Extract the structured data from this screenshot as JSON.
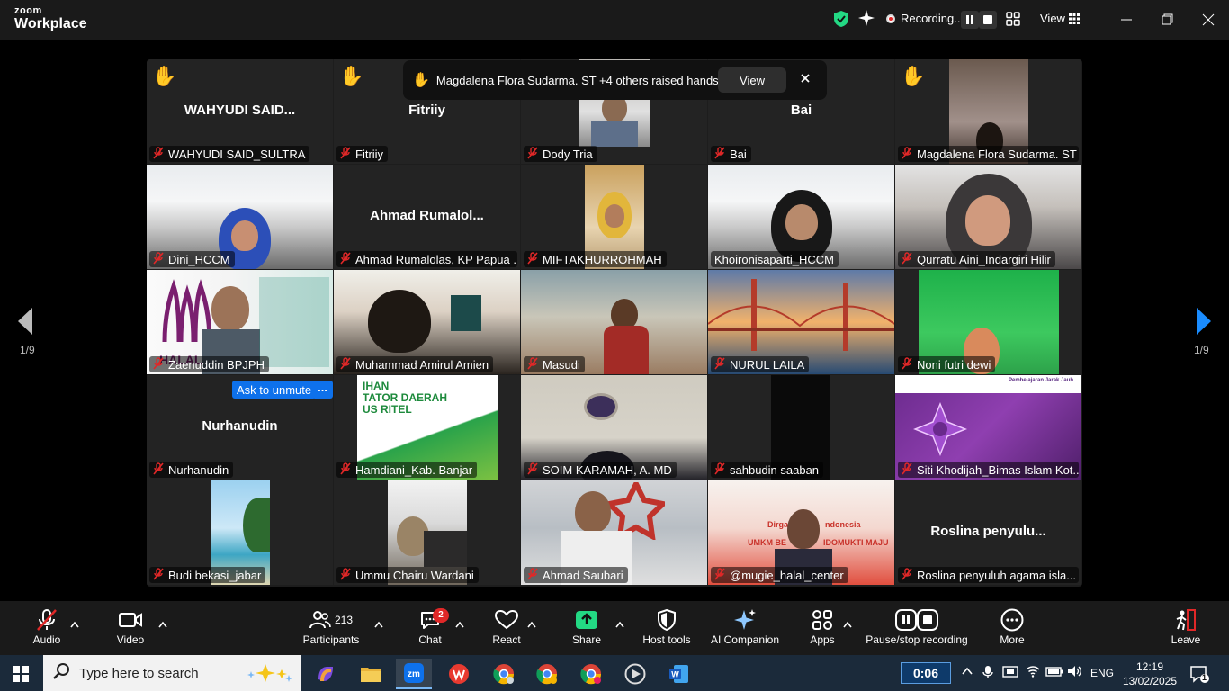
{
  "app": {
    "logo_line1": "zoom",
    "logo_line2": "Workplace",
    "recording_label": "Recording...",
    "view_label": "View"
  },
  "notification": {
    "text": "Magdalena Flora Sudarma. ST +4 others raised hands",
    "view_button": "View"
  },
  "gallery": {
    "page_left": "1/9",
    "page_right": "1/9",
    "unmute_button": "Ask to unmute",
    "more_button": "...",
    "tiles": [
      {
        "name": "WAHYUDI SAID_SULTRA",
        "big_name": "WAHYUDI SAID...",
        "hand": true,
        "video": false
      },
      {
        "name": "Fitriiy",
        "big_name": "Fitriiy",
        "hand": true,
        "video": false
      },
      {
        "name": "Dody Tria",
        "big_name": "",
        "hand": true,
        "video": true
      },
      {
        "name": "Bai",
        "big_name": "Bai",
        "hand": true,
        "video": false
      },
      {
        "name": "Magdalena Flora Sudarma. ST",
        "big_name": "",
        "hand": true,
        "video": true
      },
      {
        "name": "Dini_HCCM",
        "video": true
      },
      {
        "name": "Ahmad Rumalolas, KP Papua ...",
        "big_name": "Ahmad Rumalol...",
        "video": false
      },
      {
        "name": "MIFTAKHURROHMAH",
        "video": true
      },
      {
        "name": "Khoironisaparti_HCCM",
        "video": true,
        "active_speaker": true
      },
      {
        "name": "Qurratu Aini_Indargiri Hilir",
        "video": true
      },
      {
        "name": "Zaenuddin BPJPH",
        "video": true
      },
      {
        "name": "Muhammad Amirul Amien",
        "video": true
      },
      {
        "name": "Masudi",
        "video": true
      },
      {
        "name": "NURUL LAILA",
        "video": true
      },
      {
        "name": "Noni futri dewi",
        "video": true
      },
      {
        "name": "Nurhanudin",
        "big_name": "Nurhanudin",
        "video": false
      },
      {
        "name": "Hamdiani_Kab. Banjar",
        "video": true
      },
      {
        "name": "SOIM KARAMAH, A. MD",
        "video": true
      },
      {
        "name": "sahbudin saaban",
        "video": true
      },
      {
        "name": "Siti Khodijah_Bimas Islam Kot...",
        "video": true
      },
      {
        "name": "Budi bekasi_jabar",
        "video": true
      },
      {
        "name": "Ummu Chairu Wardani",
        "video": true
      },
      {
        "name": "Ahmad Saubari",
        "video": true
      },
      {
        "name": "@mugie_halal_center",
        "video": true
      },
      {
        "name": "Roslina penyuluh agama isla...",
        "big_name": "Roslina  penyulu...",
        "video": false
      }
    ],
    "slides": {
      "halal_text": "HALAL",
      "banner_line1": "IHAN",
      "banner_line2": "TATOR DAERAH",
      "banner_line3": "US RITEL",
      "umkm_line1": "Dirga",
      "umkm_line2": "ndonesia",
      "umkm_line3": "UMKM BE",
      "umkm_line4": "IDOMUKTI MAJU",
      "siti_title": "Pembelajaran Jarak Jauh"
    }
  },
  "toolbar": {
    "audio": "Audio",
    "video": "Video",
    "participants": "Participants",
    "participants_count": "213",
    "chat": "Chat",
    "chat_badge": "2",
    "react": "React",
    "share": "Share",
    "host_tools": "Host tools",
    "ai_companion": "AI Companion",
    "apps": "Apps",
    "pause_stop": "Pause/stop recording",
    "more": "More",
    "leave": "Leave"
  },
  "taskbar": {
    "search_placeholder": "Type here to search",
    "timer": "0:06",
    "language": "ENG",
    "time": "12:19",
    "date": "13/02/2025",
    "notification_count": "1"
  },
  "colors": {
    "zoom_blue": "#0e71eb",
    "active_speaker": "#23d984",
    "share_green": "#23d984",
    "muted_red": "#e02828"
  }
}
